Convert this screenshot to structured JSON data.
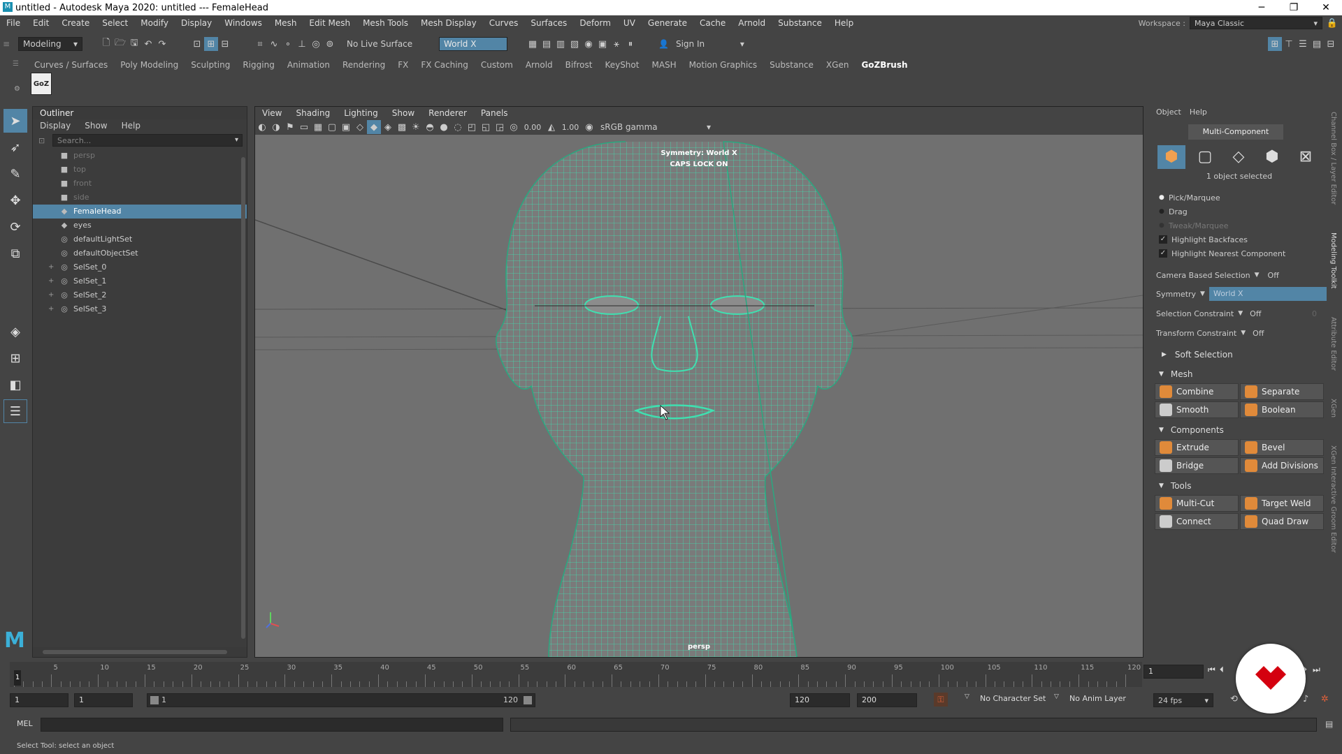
{
  "title_bar": {
    "text": "untitled - Autodesk Maya 2020: untitled   ---   FemaleHead",
    "minimize": "─",
    "restore": "❐",
    "close": "✕"
  },
  "menu": [
    "File",
    "Edit",
    "Create",
    "Select",
    "Modify",
    "Display",
    "Windows",
    "Mesh",
    "Edit Mesh",
    "Mesh Tools",
    "Mesh Display",
    "Curves",
    "Surfaces",
    "Deform",
    "UV",
    "Generate",
    "Cache",
    "Arnold",
    "Substance",
    "Help"
  ],
  "workspace": {
    "label": "Workspace :",
    "value": "Maya Classic"
  },
  "status_line": {
    "mode": "Modeling",
    "live_surface": "No Live Surface",
    "symmetry": "World X",
    "sign_in": "Sign In"
  },
  "shelf_tabs": [
    "Curves / Surfaces",
    "Poly Modeling",
    "Sculpting",
    "Rigging",
    "Animation",
    "Rendering",
    "FX",
    "FX Caching",
    "Custom",
    "Arnold",
    "Bifrost",
    "KeyShot",
    "MASH",
    "Motion Graphics",
    "Substance",
    "XGen",
    "GoZBrush"
  ],
  "shelf_active": "GoZBrush",
  "shelf_icon": "GoZ",
  "outliner": {
    "title": "Outliner",
    "menu": [
      "Display",
      "Show",
      "Help"
    ],
    "search_placeholder": "Search...",
    "items": [
      {
        "label": "persp",
        "icon": "camera-icon",
        "dim": true,
        "expand": ""
      },
      {
        "label": "top",
        "icon": "camera-icon",
        "dim": true,
        "expand": ""
      },
      {
        "label": "front",
        "icon": "camera-icon",
        "dim": true,
        "expand": ""
      },
      {
        "label": "side",
        "icon": "camera-icon",
        "dim": true,
        "expand": ""
      },
      {
        "label": "FemaleHead",
        "icon": "mesh-icon",
        "selected": true,
        "expand": ""
      },
      {
        "label": "eyes",
        "icon": "mesh-icon",
        "expand": ""
      },
      {
        "label": "defaultLightSet",
        "icon": "set-icon",
        "expand": ""
      },
      {
        "label": "defaultObjectSet",
        "icon": "set-icon",
        "expand": ""
      },
      {
        "label": "SelSet_0",
        "icon": "set-icon",
        "expand": "+"
      },
      {
        "label": "SelSet_1",
        "icon": "set-icon",
        "expand": "+"
      },
      {
        "label": "SelSet_2",
        "icon": "set-icon",
        "expand": "+"
      },
      {
        "label": "SelSet_3",
        "icon": "set-icon",
        "expand": "+"
      }
    ]
  },
  "viewport": {
    "menu": [
      "View",
      "Shading",
      "Lighting",
      "Show",
      "Renderer",
      "Panels"
    ],
    "exposure": "0.00",
    "gamma": "1.00",
    "color_space": "sRGB gamma",
    "hud_symmetry": "Symmetry: World X",
    "hud_caps": "CAPS LOCK ON",
    "camera": "persp"
  },
  "toolkit": {
    "menu": [
      "Object",
      "Help"
    ],
    "mode_button": "Multi-Component",
    "selected_text": "1 object selected",
    "radio_options": [
      "Pick/Marquee",
      "Drag",
      "Tweak/Marquee"
    ],
    "checkboxes": [
      "Highlight Backfaces",
      "Highlight Nearest Component"
    ],
    "camera_based": {
      "label": "Camera Based Selection",
      "value": "Off"
    },
    "symmetry": {
      "label": "Symmetry",
      "value": "World X"
    },
    "selection_constraint": {
      "label": "Selection Constraint",
      "value": "Off",
      "num": "0"
    },
    "transform_constraint": {
      "label": "Transform Constraint",
      "value": "Off"
    },
    "soft_selection": "Soft Selection",
    "sections": [
      {
        "title": "Mesh",
        "buttons": [
          "Combine",
          "Separate",
          "Smooth",
          "Boolean"
        ]
      },
      {
        "title": "Components",
        "buttons": [
          "Extrude",
          "Bevel",
          "Bridge",
          "Add Divisions"
        ]
      },
      {
        "title": "Tools",
        "buttons": [
          "Multi-Cut",
          "Target Weld",
          "Connect",
          "Quad Draw"
        ]
      }
    ],
    "side_tabs": [
      "Channel Box / Layer Editor",
      "Modeling Toolkit",
      "Attribute Editor",
      "XGen",
      "XGen Interactive Groom Editor"
    ]
  },
  "timeline": {
    "ticks": [
      "5",
      "10",
      "15",
      "20",
      "25",
      "30",
      "35",
      "40",
      "45",
      "50",
      "55",
      "60",
      "65",
      "70",
      "75",
      "80",
      "85",
      "90",
      "95",
      "100",
      "105",
      "110",
      "115",
      "120"
    ],
    "start_frame": "1",
    "current_frame": "1"
  },
  "range": {
    "start": "1",
    "playback_start": "1",
    "slider_start": "1",
    "slider_end": "120",
    "playback_end": "120",
    "end": "200",
    "character_set": "No Character Set",
    "anim_layer": "No Anim Layer",
    "fps": "24 fps"
  },
  "mel": {
    "label": "MEL"
  },
  "help_line": "Select Tool: select an object",
  "colors": {
    "wire": "#3fe0b0",
    "selection": "#5285a6",
    "bg": "#444444",
    "viewport": "#707070"
  }
}
